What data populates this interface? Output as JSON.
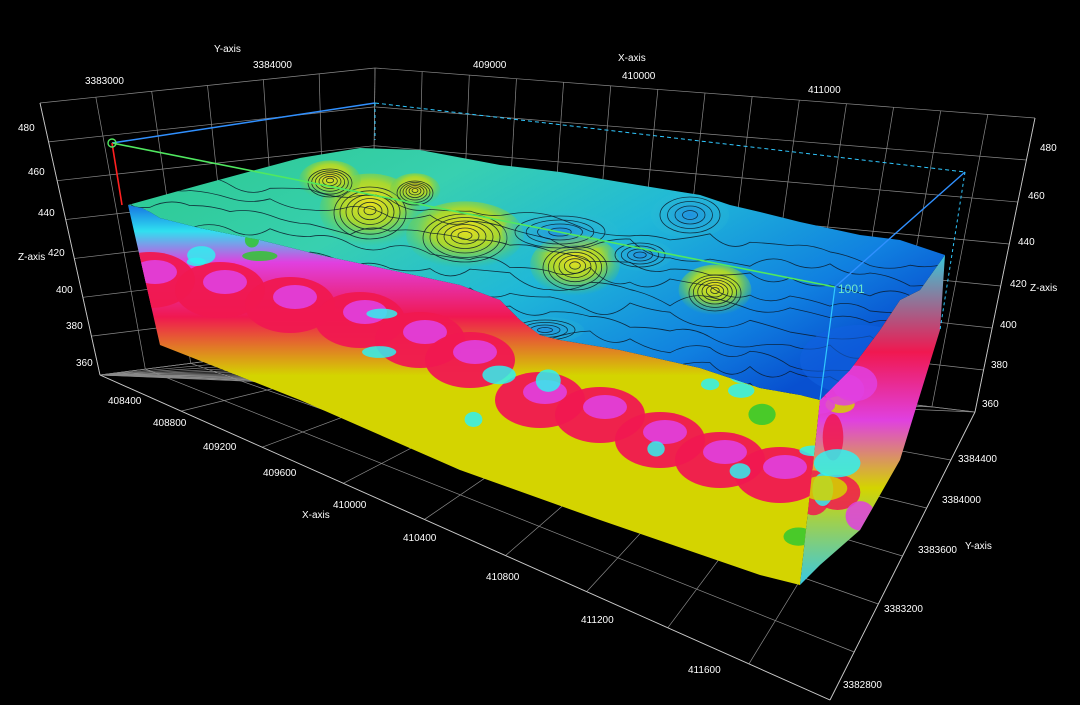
{
  "chart_data": {
    "type": "3d-volume",
    "title": "",
    "axes": {
      "x": {
        "label": "X-axis",
        "ticks_front": [
          "408400",
          "408800",
          "409200",
          "409600",
          "410000",
          "410400",
          "410800",
          "411200",
          "411600"
        ],
        "ticks_back": [
          "409000",
          "410000",
          "411000"
        ]
      },
      "y": {
        "label": "Y-axis",
        "ticks_right": [
          "3384400",
          "3384000",
          "3383600",
          "3383200",
          "3382800"
        ],
        "ticks_back": [
          "3383000",
          "3384000"
        ]
      },
      "z": {
        "label": "Z-axis",
        "ticks": [
          "480",
          "460",
          "440",
          "420",
          "400",
          "380",
          "360"
        ],
        "range": [
          350,
          490
        ]
      }
    },
    "x_range": [
      408200,
      411800
    ],
    "y_range": [
      3382800,
      3384600
    ],
    "annotations": [
      {
        "text": "1001"
      }
    ],
    "colors": {
      "magenta": "#e040e0",
      "red": "#f01850",
      "yellow": "#d4d400",
      "green": "#30c830",
      "cyan": "#30f0f0",
      "blue": "#1060e0",
      "grid": "#8a8a8a"
    }
  }
}
